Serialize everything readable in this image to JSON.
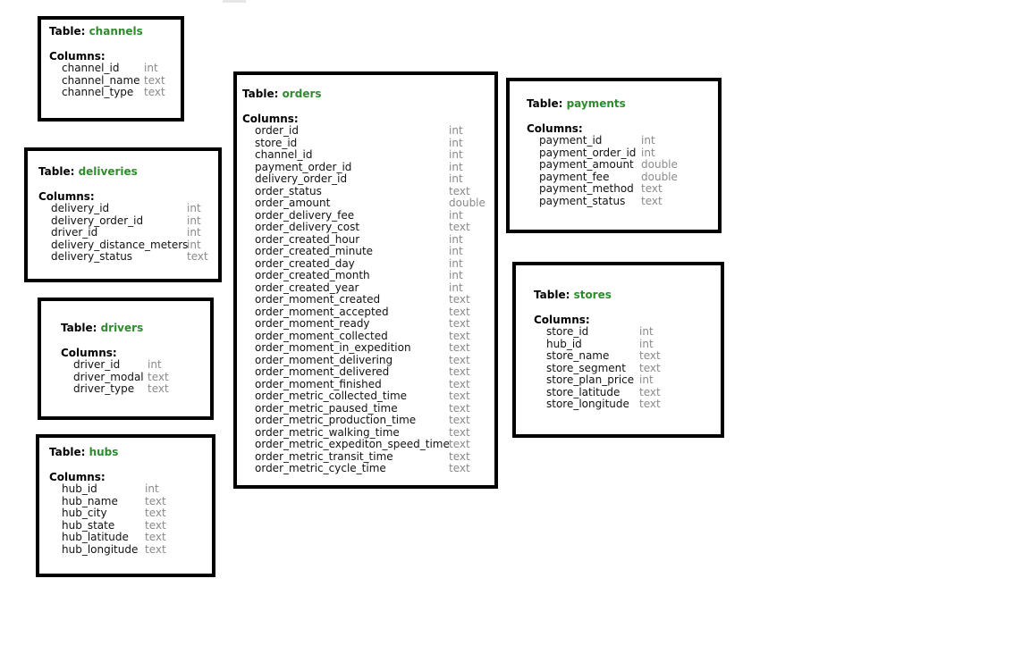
{
  "tables": {
    "channels": {
      "prefix": "Table: ",
      "name": "channels",
      "columns_label": "Columns:",
      "columns": [
        {
          "name": "channel_id",
          "type": "int"
        },
        {
          "name": "channel_name",
          "type": "text"
        },
        {
          "name": "channel_type",
          "type": "text"
        }
      ]
    },
    "deliveries": {
      "prefix": "Table: ",
      "name": "deliveries",
      "columns_label": "Columns:",
      "columns": [
        {
          "name": "delivery_id",
          "type": "int"
        },
        {
          "name": "delivery_order_id",
          "type": "int"
        },
        {
          "name": "driver_id",
          "type": "int"
        },
        {
          "name": "delivery_distance_meters",
          "type": "int"
        },
        {
          "name": "delivery_status",
          "type": "text"
        }
      ]
    },
    "drivers": {
      "prefix": "Table: ",
      "name": "drivers",
      "columns_label": "Columns:",
      "columns": [
        {
          "name": "driver_id",
          "type": "int"
        },
        {
          "name": "driver_modal",
          "type": "text"
        },
        {
          "name": "driver_type",
          "type": "text"
        }
      ]
    },
    "hubs": {
      "prefix": "Table: ",
      "name": "hubs",
      "columns_label": "Columns:",
      "columns": [
        {
          "name": "hub_id",
          "type": "int"
        },
        {
          "name": "hub_name",
          "type": "text"
        },
        {
          "name": "hub_city",
          "type": "text"
        },
        {
          "name": "hub_state",
          "type": "text"
        },
        {
          "name": "hub_latitude",
          "type": "text"
        },
        {
          "name": "hub_longitude",
          "type": "text"
        }
      ]
    },
    "orders": {
      "prefix": "Table: ",
      "name": "orders",
      "columns_label": "Columns:",
      "columns": [
        {
          "name": "order_id",
          "type": "int"
        },
        {
          "name": "store_id",
          "type": "int"
        },
        {
          "name": "channel_id",
          "type": "int"
        },
        {
          "name": "payment_order_id",
          "type": "int"
        },
        {
          "name": "delivery_order_id",
          "type": "int"
        },
        {
          "name": "order_status",
          "type": "text"
        },
        {
          "name": "order_amount",
          "type": "double"
        },
        {
          "name": "order_delivery_fee",
          "type": "int"
        },
        {
          "name": "order_delivery_cost",
          "type": "text"
        },
        {
          "name": "order_created_hour",
          "type": "int"
        },
        {
          "name": "order_created_minute",
          "type": "int"
        },
        {
          "name": "order_created_day",
          "type": "int"
        },
        {
          "name": "order_created_month",
          "type": "int"
        },
        {
          "name": "order_created_year",
          "type": "int"
        },
        {
          "name": "order_moment_created",
          "type": "text"
        },
        {
          "name": "order_moment_accepted",
          "type": "text"
        },
        {
          "name": "order_moment_ready",
          "type": "text"
        },
        {
          "name": "order_moment_collected",
          "type": "text"
        },
        {
          "name": "order_moment_in_expedition",
          "type": "text"
        },
        {
          "name": "order_moment_delivering",
          "type": "text"
        },
        {
          "name": "order_moment_delivered",
          "type": "text"
        },
        {
          "name": "order_moment_finished",
          "type": "text"
        },
        {
          "name": "order_metric_collected_time",
          "type": "text"
        },
        {
          "name": "order_metric_paused_time",
          "type": "text"
        },
        {
          "name": "order_metric_production_time",
          "type": "text"
        },
        {
          "name": "order_metric_walking_time",
          "type": "text"
        },
        {
          "name": "order_metric_expediton_speed_time",
          "type": "text"
        },
        {
          "name": "order_metric_transit_time",
          "type": "text"
        },
        {
          "name": "order_metric_cycle_time",
          "type": "text"
        }
      ]
    },
    "payments": {
      "prefix": "Table: ",
      "name": "payments",
      "columns_label": "Columns:",
      "columns": [
        {
          "name": "payment_id",
          "type": "int"
        },
        {
          "name": "payment_order_id",
          "type": "int"
        },
        {
          "name": "payment_amount",
          "type": "double"
        },
        {
          "name": "payment_fee",
          "type": "double"
        },
        {
          "name": "payment_method",
          "type": "text"
        },
        {
          "name": "payment_status",
          "type": "text"
        }
      ]
    },
    "stores": {
      "prefix": "Table: ",
      "name": "stores",
      "columns_label": "Columns:",
      "columns": [
        {
          "name": "store_id",
          "type": "int"
        },
        {
          "name": "hub_id",
          "type": "int"
        },
        {
          "name": "store_name",
          "type": "text"
        },
        {
          "name": "store_segment",
          "type": "text"
        },
        {
          "name": "store_plan_price",
          "type": "int"
        },
        {
          "name": "store_latitude",
          "type": "text"
        },
        {
          "name": "store_longitude",
          "type": "text"
        }
      ]
    }
  },
  "colors": {
    "table_name": "#2e8b2e",
    "column_type": "#8a8a8a",
    "border": "#000000"
  }
}
